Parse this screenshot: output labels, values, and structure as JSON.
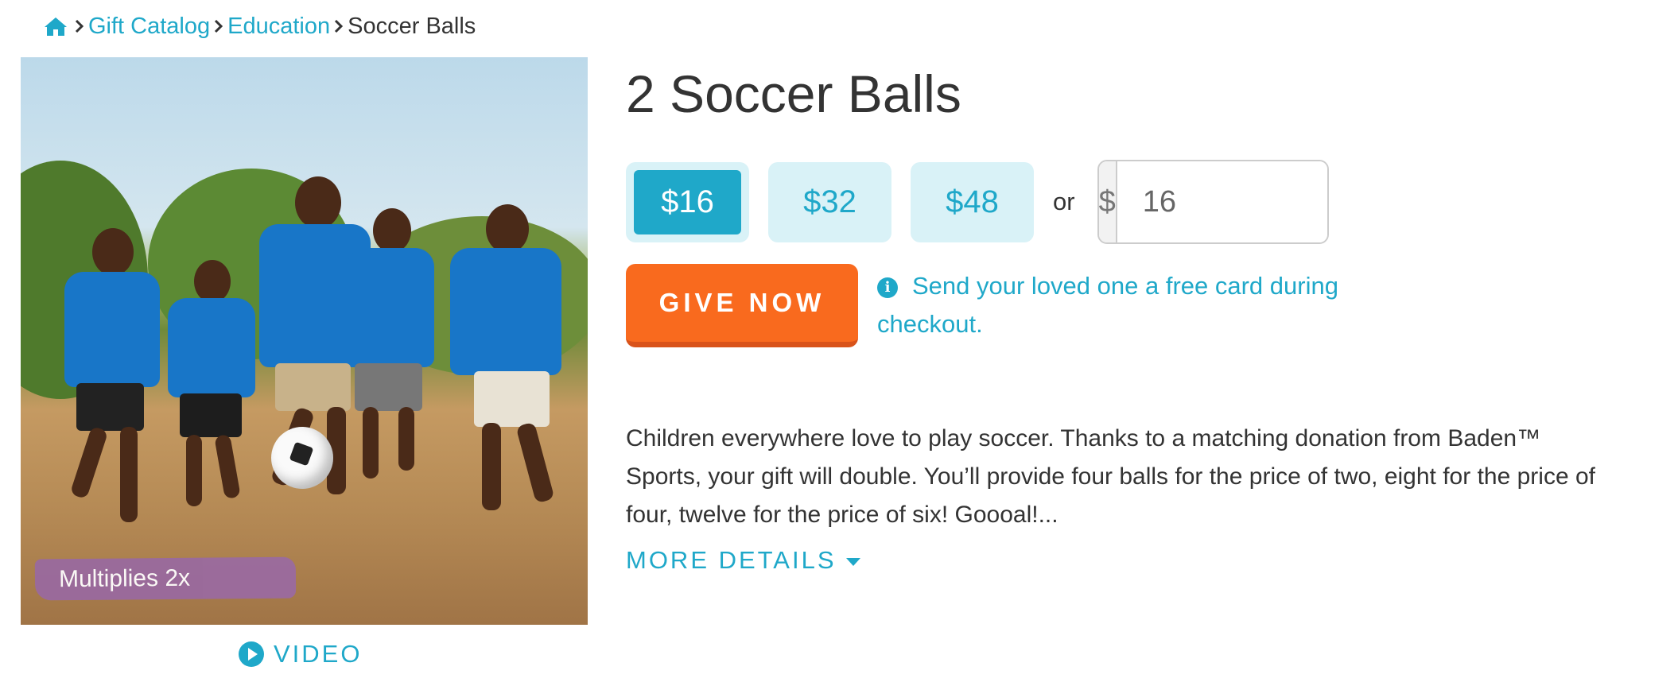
{
  "breadcrumb": {
    "home_icon": "home-icon",
    "items": [
      "Gift Catalog",
      "Education"
    ],
    "current": "Soccer Balls"
  },
  "image": {
    "badge": "Multiplies 2x",
    "video_label": "VIDEO"
  },
  "product": {
    "title": "2 Soccer Balls",
    "amounts": [
      "$16",
      "$32",
      "$48"
    ],
    "selected_amount": "$16",
    "or_label": "or",
    "currency_symbol": "$",
    "custom_value": "16",
    "give_label": "GIVE NOW",
    "card_info": "Send your loved one a free card during checkout.",
    "description": "Children everywhere love to play soccer. Thanks to a matching donation from Baden™ Sports, your gift will double. You’ll provide four balls for the price of two, eight for the price of four, twelve for the price of six! Goooal!...",
    "more_details": "MORE DETAILS"
  },
  "colors": {
    "accent": "#1fa8c9",
    "give_button": "#f96a1e",
    "badge": "#9a6a9f",
    "amount_bg": "#d9f2f7"
  }
}
